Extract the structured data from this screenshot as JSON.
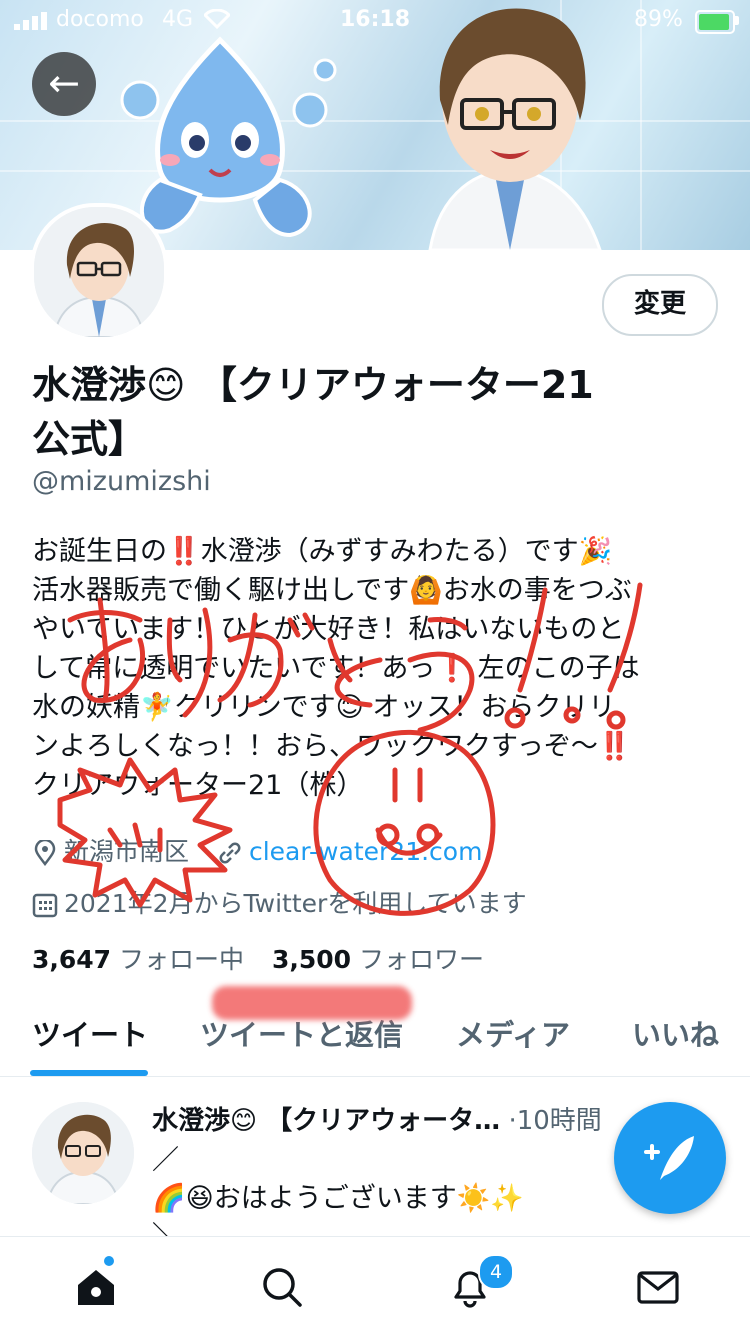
{
  "status_bar": {
    "carrier": "docomo",
    "network": "4G",
    "time": "16:18",
    "battery": "89%"
  },
  "header": {
    "back_icon": "arrow-left-icon"
  },
  "profile": {
    "change_button": "変更",
    "name_line1": "水澄渉😊 【クリアウォーター21",
    "name_line2": "公式】",
    "handle": "@mizumizshi",
    "bio_lines": [
      "お誕生日の‼️水澄渉（みずすみわたる）です🎉",
      "活水器販売で働く駆け出しです🙆お水の事をつぶ",
      "やいています！ひとが大好き！私はいないものと",
      "して常に透明でいたいです！あっ❗ 左のこの子は",
      "水の妖精🧚クリリンです😊 オッス！おらクリリ",
      "ンよろしくなっ！！おら、ワックワクすっぞ〜‼️",
      "クリアウォーター21（株）"
    ],
    "location": "新潟市南区",
    "website": "clear-water21.com",
    "joined": "2021年2月からTwitterを利用しています",
    "following_count": "3,647",
    "following_label": "フォロー中",
    "followers_count": "3,500",
    "followers_label": "フォロワー"
  },
  "tabs": [
    {
      "label": "ツイート",
      "active": true
    },
    {
      "label": "ツイートと返信",
      "active": false
    },
    {
      "label": "メディア",
      "active": false
    },
    {
      "label": "いいね",
      "active": false
    }
  ],
  "tweet": {
    "author": "水澄渉😊 【クリアウォータ…",
    "time": "·10時間",
    "line1": "／",
    "line2": "🌈😆おはようございます☀️✨",
    "line3": "＼"
  },
  "nav": {
    "notifications_badge": "4",
    "items": [
      "home-icon",
      "search-icon",
      "bell-icon",
      "mail-icon"
    ]
  },
  "colors": {
    "accent": "#1d9bf0",
    "scribble": "#e0382e"
  }
}
